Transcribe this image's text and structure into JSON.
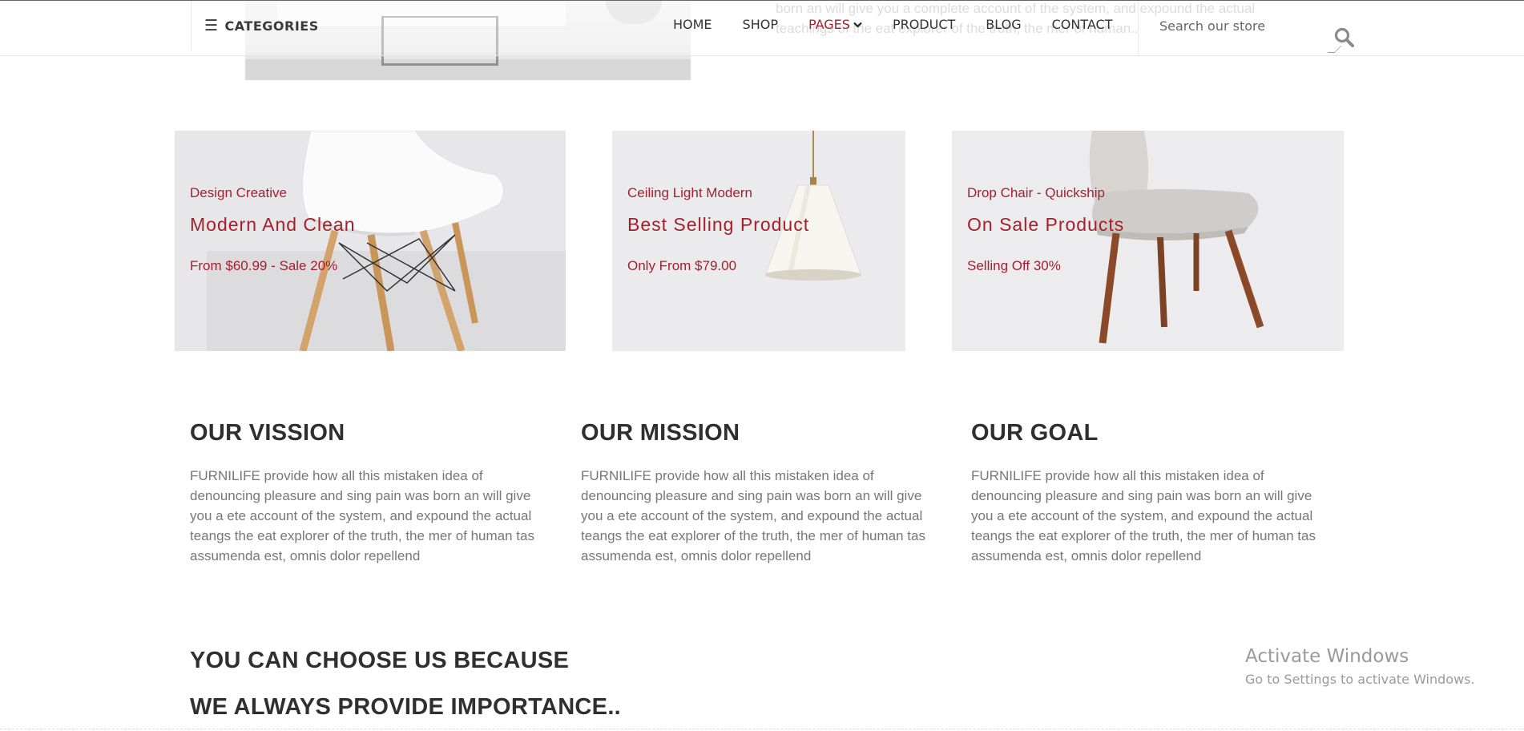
{
  "hero": {
    "text_line1": "born an will give you a complete account of the system, and expound the actual",
    "text_line2": "teachings of the eat explorer of the truth, the mer of human.."
  },
  "header": {
    "categories_label": "CATEGORIES",
    "nav": [
      {
        "label": "HOME"
      },
      {
        "label": "SHOP"
      },
      {
        "label": "PAGES",
        "active": true,
        "has_dropdown": true
      },
      {
        "label": "PRODUCT"
      },
      {
        "label": "BLOG"
      },
      {
        "label": "CONTACT"
      }
    ],
    "search_placeholder": "Search our store"
  },
  "banners": [
    {
      "pre": "Design Creative",
      "title": "Modern And Clean",
      "price": "From $60.99 - Sale 20%",
      "image": "white-eames-chair"
    },
    {
      "pre": "Ceiling Light Modern",
      "title": "Best Selling Product",
      "price": "Only From $79.00",
      "image": "pendant-lamp"
    },
    {
      "pre": "Drop Chair - Quickship",
      "title": "On Sale Products",
      "price": "Selling Off 30%",
      "image": "upholstered-chair"
    }
  ],
  "about": [
    {
      "title": "OUR VISSION",
      "body": "FURNILIFE provide how all this mistaken idea of denouncing pleasure and sing pain was born an will give you a ete account of the system, and expound the actual teangs the eat explorer of the truth, the mer of human tas assumenda est, omnis dolor repellend"
    },
    {
      "title": "OUR MISSION",
      "body": "FURNILIFE provide how all this mistaken idea of denouncing pleasure and sing pain was born an will give you a ete account of the system, and expound the actual teangs the eat explorer of the truth, the mer of human tas assumenda est, omnis dolor repellend"
    },
    {
      "title": "OUR GOAL",
      "body": "FURNILIFE provide how all this mistaken idea of denouncing pleasure and sing pain was born an will give you a ete account of the system, and expound the actual teangs the eat explorer of the truth, the mer of human tas assumenda est, omnis dolor repellend"
    }
  ],
  "why": {
    "line1": "YOU CAN CHOOSE US BECAUSE",
    "line2": "WE ALWAYS PROVIDE IMPORTANCE.."
  },
  "watermark": {
    "title": "Activate Windows",
    "subtitle": "Go to Settings to activate Windows."
  },
  "colors": {
    "accent": "#a5202d",
    "heading": "#2f2f2f",
    "body_text": "#777777",
    "banner_bg": "#e9e9ec"
  },
  "icons": {
    "categories": "hamburger-icon",
    "search": "search-icon",
    "dropdown": "chevron-down-icon"
  }
}
